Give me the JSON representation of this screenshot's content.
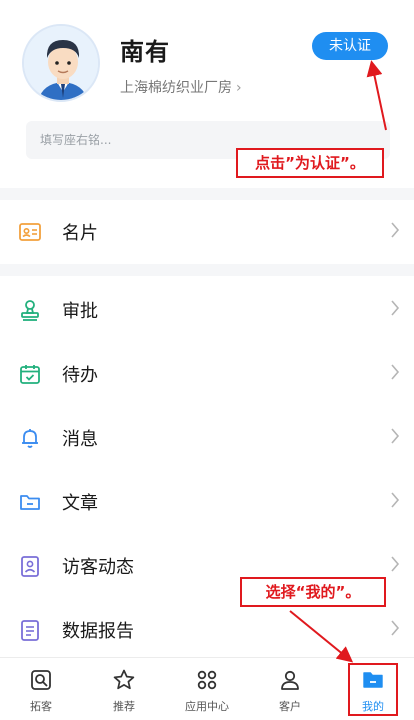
{
  "profile": {
    "name": "南有",
    "company": "上海棉纺织业厂房",
    "verify_label": "未认证",
    "motto_placeholder": "填写座右铭..."
  },
  "annotations": {
    "top_note": "点击”为认证”。",
    "bottom_note": "选择“我的”。"
  },
  "menu": {
    "card": "名片",
    "approval": "审批",
    "todo": "待办",
    "messages": "消息",
    "articles": "文章",
    "visitor": "访客动态",
    "reports": "数据报告"
  },
  "nav": {
    "items": [
      {
        "label": "拓客",
        "icon": "search-doc-icon"
      },
      {
        "label": "推荐",
        "icon": "star-icon"
      },
      {
        "label": "应用中心",
        "icon": "apps-grid-icon"
      },
      {
        "label": "客户",
        "icon": "person-icon"
      },
      {
        "label": "我的",
        "icon": "folder-icon"
      }
    ],
    "active_index": 4
  },
  "colors": {
    "accent": "#1f8ef1",
    "annotation_red": "#e0191e",
    "icon_orange": "#f2a03d",
    "icon_green": "#22b07d",
    "icon_purple": "#7a6fd8",
    "icon_blue": "#3b8cf0"
  }
}
